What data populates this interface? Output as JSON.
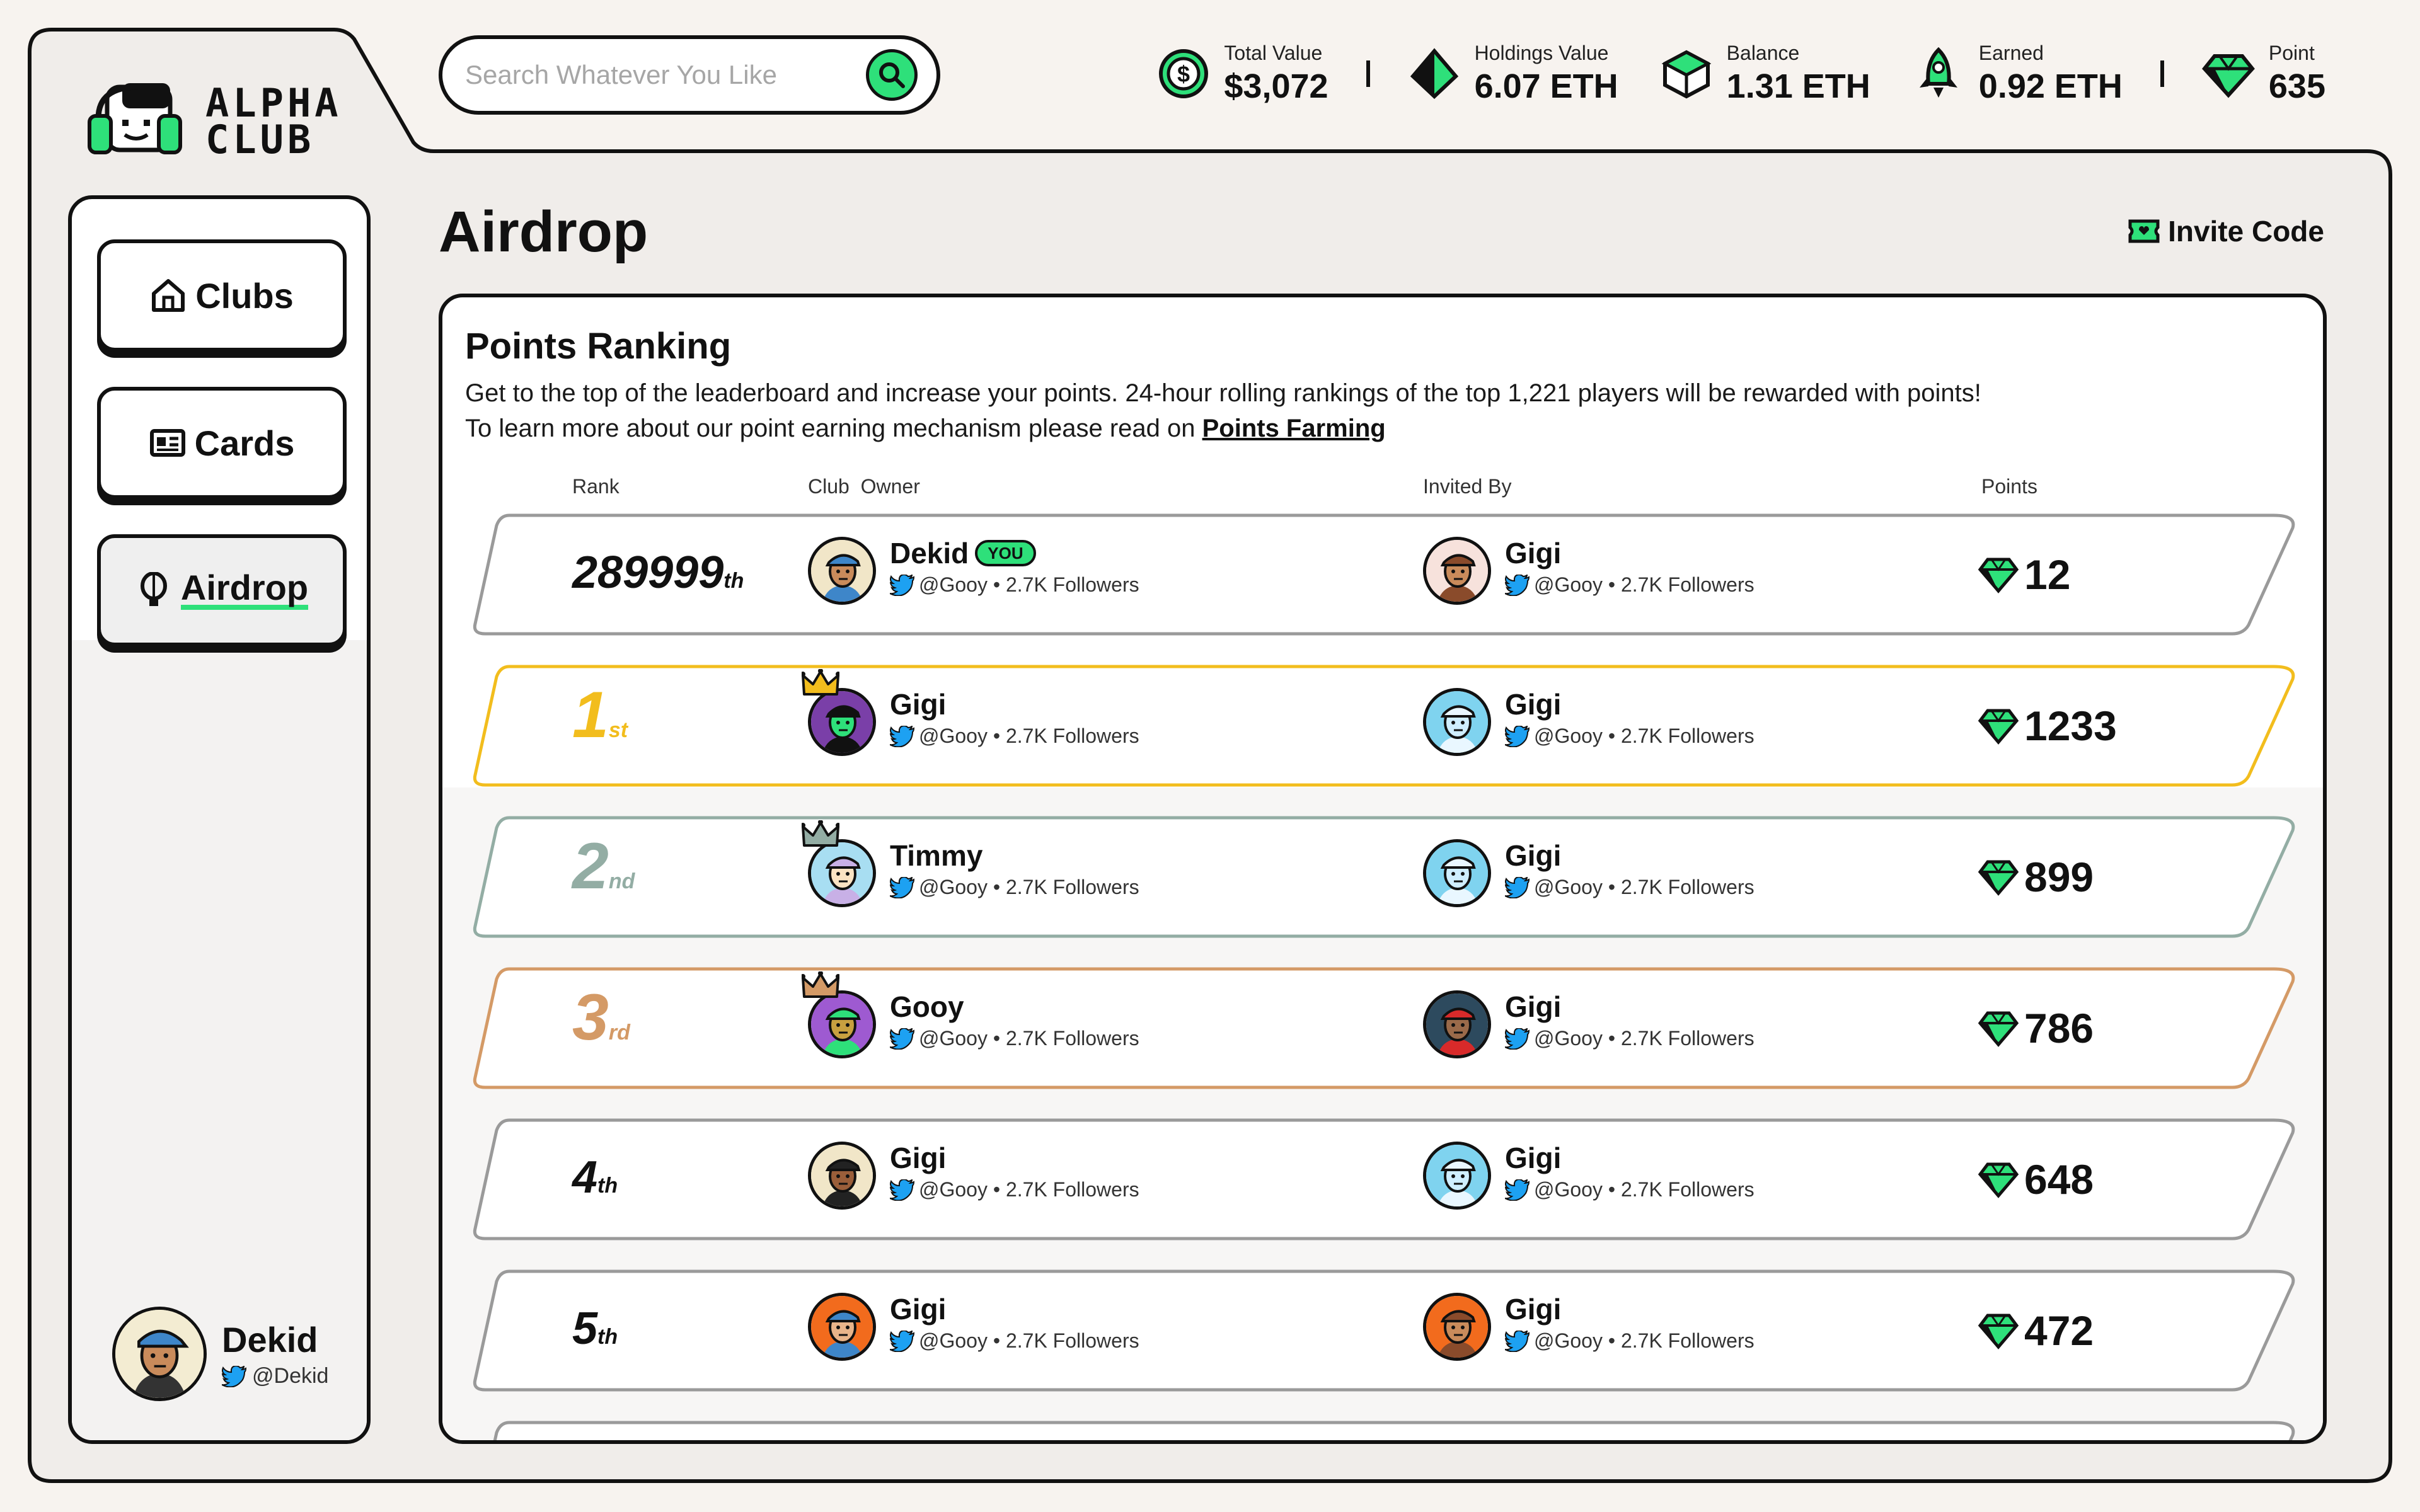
{
  "app": {
    "logo_line1": "ALPHA",
    "logo_line2": "CLUB"
  },
  "search": {
    "placeholder": "Search Whatever You Like"
  },
  "stats": [
    {
      "label": "Total Value",
      "value": "$3,072",
      "icon": "coin-icon"
    },
    {
      "label": "Holdings Value",
      "value": "6.07 ETH",
      "icon": "ethereum-icon"
    },
    {
      "label": "Balance",
      "value": "1.31 ETH",
      "icon": "cube-icon"
    },
    {
      "label": "Earned",
      "value": "0.92 ETH",
      "icon": "rocket-icon"
    },
    {
      "label": "Point",
      "value": "635",
      "icon": "gem-icon"
    }
  ],
  "sidebar": {
    "items": [
      {
        "label": "Clubs",
        "icon": "home-icon"
      },
      {
        "label": "Cards",
        "icon": "card-icon"
      },
      {
        "label": "Airdrop",
        "icon": "balloon-icon",
        "active": true
      }
    ],
    "user": {
      "name": "Dekid",
      "handle": "@Dekid"
    }
  },
  "page": {
    "title": "Airdrop",
    "invite_label": "Invite Code"
  },
  "ranking": {
    "title": "Points Ranking",
    "desc_line1": "Get to the top of the leaderboard and increase your points. 24-hour rolling rankings of the top 1,221 players will be rewarded with points!",
    "desc_line2": "To learn more about our point earning mechanism please read on ",
    "link": "Points Farming",
    "columns": {
      "rank": "Rank",
      "club_owner": "Club  Owner",
      "invited_by": "Invited By",
      "points": "Points"
    },
    "rows": [
      {
        "rank": "289999",
        "suffix": "th",
        "owner": "Dekid",
        "you": "YOU",
        "owner_meta": "@Gooy • 2.7K Followers",
        "inviter": "Gigi",
        "inviter_meta": "@Gooy • 2.7K Followers",
        "points": "12",
        "accent": "#9a9a9a"
      },
      {
        "rank": "1",
        "suffix": "st",
        "owner": "Gigi",
        "owner_meta": "@Gooy • 2.7K Followers",
        "inviter": "Gigi",
        "inviter_meta": "@Gooy • 2.7K Followers",
        "points": "1233",
        "accent": "#f2bd1d"
      },
      {
        "rank": "2",
        "suffix": "nd",
        "owner": "Timmy",
        "owner_meta": "@Gooy • 2.7K Followers",
        "inviter": "Gigi",
        "inviter_meta": "@Gooy • 2.7K Followers",
        "points": "899",
        "accent": "#93ada4"
      },
      {
        "rank": "3",
        "suffix": "rd",
        "owner": "Gooy",
        "owner_meta": "@Gooy • 2.7K Followers",
        "inviter": "Gigi",
        "inviter_meta": "@Gooy • 2.7K Followers",
        "points": "786",
        "accent": "#d49a66"
      },
      {
        "rank": "4",
        "suffix": "th",
        "owner": "Gigi",
        "owner_meta": "@Gooy • 2.7K Followers",
        "inviter": "Gigi",
        "inviter_meta": "@Gooy • 2.7K Followers",
        "points": "648",
        "accent": "#9a9a9a"
      },
      {
        "rank": "5",
        "suffix": "th",
        "owner": "Gigi",
        "owner_meta": "@Gooy • 2.7K Followers",
        "inviter": "Gigi",
        "inviter_meta": "@Gooy • 2.7K Followers",
        "points": "472",
        "accent": "#9a9a9a"
      }
    ]
  },
  "colors": {
    "accent_green": "#2ee07a",
    "gold": "#f2bd1d",
    "silver": "#93ada4",
    "bronze": "#d49a66",
    "twitter": "#1da1f2"
  }
}
